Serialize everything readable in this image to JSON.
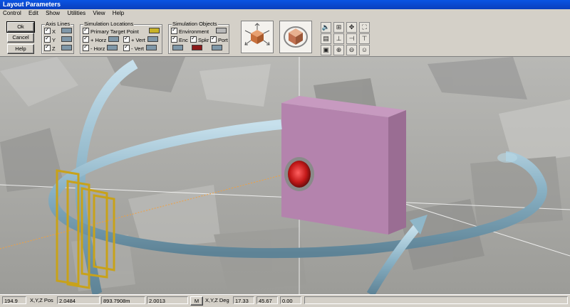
{
  "window": {
    "title": "Layout Parameters"
  },
  "menu": [
    "Control",
    "Edit",
    "Show",
    "Utilities",
    "View",
    "Help"
  ],
  "buttons": {
    "ok": "Ok",
    "cancel": "Cancel",
    "help": "Help"
  },
  "axis_lines": {
    "title": "Axis Lines",
    "items": [
      {
        "label": "X",
        "checked": true
      },
      {
        "label": "Y",
        "checked": true
      },
      {
        "label": "Z",
        "checked": true
      }
    ]
  },
  "sim_locations": {
    "title": "Simulation Locations",
    "primary": "Primary Target Point",
    "plus_horz": "+ Horz",
    "plus_vert": "+ Vert",
    "minus_horz": "- Horz",
    "minus_vert": "- Vert"
  },
  "sim_objects": {
    "title": "Simulation Objects",
    "environment": "Environment",
    "enc": "Enc",
    "spkr": "Spkr",
    "port": "Port"
  },
  "colors": {
    "swatch_default": "#7f97a8",
    "swatch_gold": "#c8b228",
    "swatch_red": "#8b1a1a",
    "box": "#b483ad",
    "tube": "#8fb6c8",
    "frame": "#c8a21a"
  },
  "status": {
    "value1": "194.9",
    "pos_label": "X,Y,Z Pos",
    "x": "2.0484",
    "y": "893.7908m",
    "z": "2.0013",
    "m_button": "M",
    "deg_label": "X,Y,Z Deg",
    "deg_x": "17.33",
    "deg_y": "45.67",
    "deg_z": "0.00"
  }
}
